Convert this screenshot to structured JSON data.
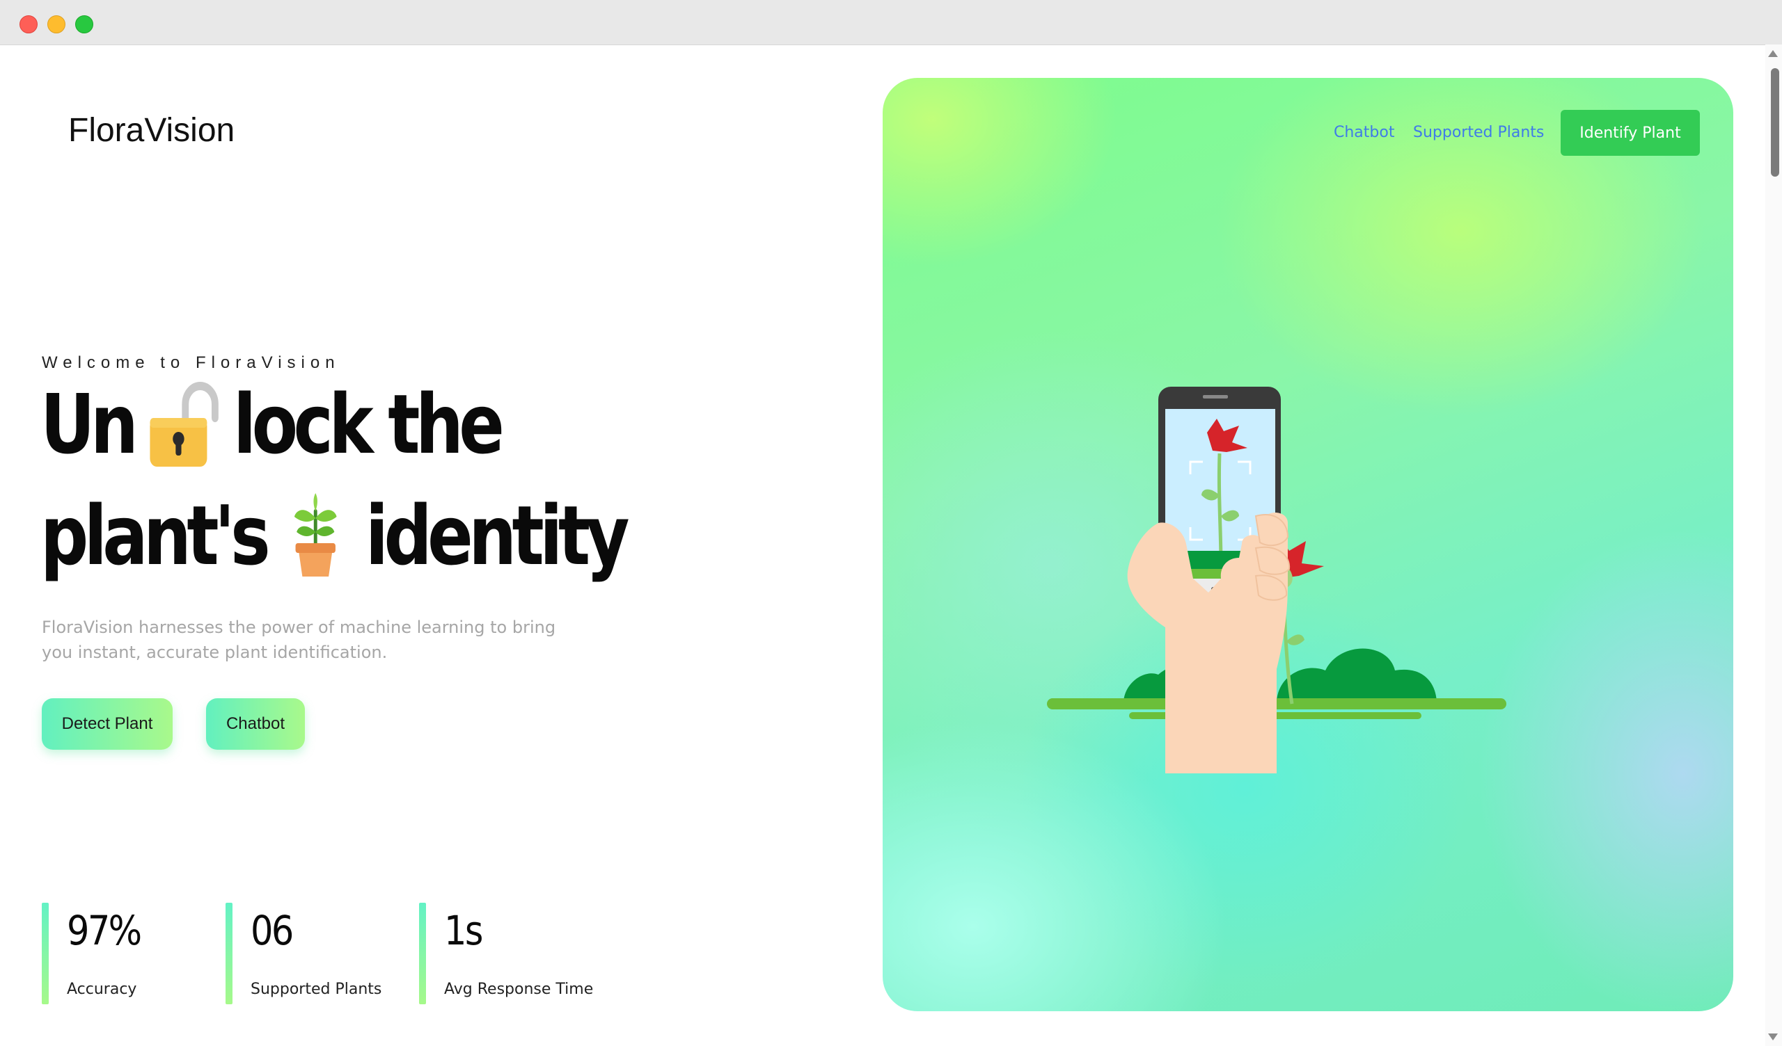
{
  "brand": {
    "name": "FloraVision"
  },
  "hero": {
    "welcome": "Welcome to FloraVision",
    "headline": {
      "w1": "Un",
      "w2": "lock the",
      "w3": "plant's",
      "w4": "identity"
    },
    "subtitle": "FloraVision harnesses the power of machine learning to bring you instant, accurate plant identification.",
    "buttons": {
      "detect": "Detect Plant",
      "chatbot": "Chatbot"
    }
  },
  "stats": [
    {
      "value": "97%",
      "label": "Accuracy"
    },
    {
      "value": "06",
      "label": "Supported Plants"
    },
    {
      "value": "1s",
      "label": "Avg Response Time"
    }
  ],
  "nav": {
    "chatbot": "Chatbot",
    "supported_plants": "Supported Plants",
    "identify": "Identify Plant"
  },
  "icons": {
    "lock": "open-padlock-icon",
    "plant": "potted-seedling-icon",
    "camera": "camera-icon"
  },
  "colors": {
    "accent_green": "#33cc55",
    "link_blue": "#3f7be8",
    "gradient_start": "#62f0bf",
    "gradient_end": "#a9f98b"
  }
}
